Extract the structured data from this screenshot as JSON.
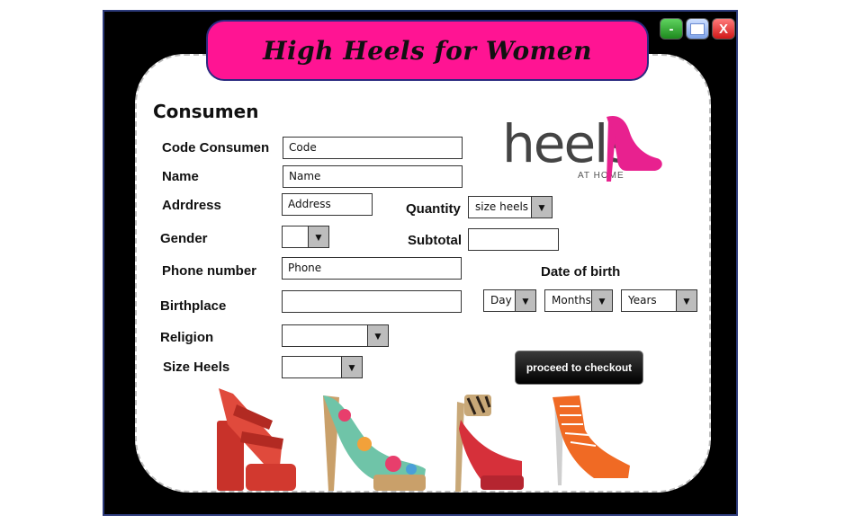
{
  "window": {
    "title": "High Heels for Women",
    "controls": {
      "minimize": "-",
      "close": "X"
    }
  },
  "form": {
    "section_title": "Consumen",
    "labels": {
      "code": "Code Consumen",
      "name": "Name",
      "address": "Adrdress",
      "gender": "Gender",
      "phone": "Phone number",
      "birthplace": "Birthplace",
      "religion": "Religion",
      "size_heels": "Size Heels",
      "quantity": "Quantity",
      "subtotal": "Subtotal",
      "date_of_birth": "Date of birth"
    },
    "fields": {
      "code": "Code",
      "name": "Name",
      "address": "Address",
      "phone": "Phone",
      "birthplace": "",
      "subtotal": ""
    },
    "selects": {
      "gender": "",
      "religion": "",
      "size_heels": "",
      "quantity": "size heels",
      "day": "Day",
      "months": "Months",
      "years": "Years"
    },
    "checkout_label": "proceed to checkout"
  },
  "logo": {
    "text": "heels",
    "subtext": "AT HOME"
  },
  "colors": {
    "title_bg": "#ff1493",
    "logo_pink": "#e8218f",
    "window_bg": "#000000"
  },
  "products": [
    "red-strappy-platform-heel-image",
    "floral-platform-pump-image",
    "zebra-print-ankle-strap-heel-image",
    "orange-lace-up-heel-image"
  ]
}
